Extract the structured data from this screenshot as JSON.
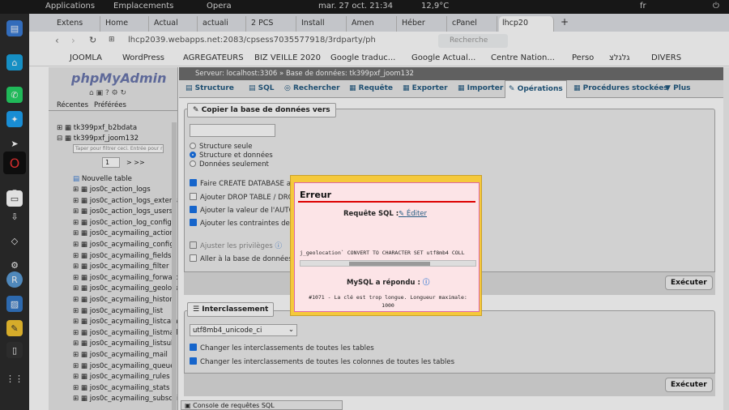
{
  "system": {
    "applications": "Applications",
    "places": "Emplacements",
    "browser": "Opera",
    "datetime": "mar. 27 oct. 21:34",
    "temp": "12,9°C",
    "lang": "fr"
  },
  "tabs": [
    "Extens",
    "Home",
    "Actual",
    "actuali",
    "2 PCS",
    "Install",
    "Amen",
    "Héber",
    "cPanel",
    "lhcp20"
  ],
  "url": "lhcp2039.webapps.net:2083/cpsess7035577918/3rdparty/ph",
  "search_placeholder": "Recherche",
  "bookmarks": [
    "JOOMLA",
    "WordPress",
    "AGREGATEURS",
    "BIZ VEILLE 2020",
    "Google traduc...",
    "Google Actual...",
    "Centre Nation...",
    "Perso",
    "גלגלצ",
    "DIVERS"
  ],
  "sidebar": {
    "logo": "phpMyAdmin",
    "tab_recent": "Récentes",
    "tab_prefs": "Préférées",
    "db1": "tk399pxf_b2bdata",
    "db2": "tk399pxf_joom132",
    "filter_placeholder": "Taper pour filtrer ceci. Entrée pour r",
    "page": "1",
    "next": "> >>",
    "new_table": "Nouvelle table",
    "tables": [
      "jos0c_action_logs",
      "jos0c_action_logs_extensi",
      "jos0c_action_logs_users",
      "jos0c_action_log_config",
      "jos0c_acymailing_action",
      "jos0c_acymailing_config",
      "jos0c_acymailing_fields",
      "jos0c_acymailing_filter",
      "jos0c_acymailing_forward",
      "jos0c_acymailing_geolocat",
      "jos0c_acymailing_history",
      "jos0c_acymailing_list",
      "jos0c_acymailing_listcamp",
      "jos0c_acymailing_listmail",
      "jos0c_acymailing_listsub",
      "jos0c_acymailing_mail",
      "jos0c_acymailing_queue",
      "jos0c_acymailing_rules",
      "jos0c_acymailing_stats",
      "jos0c_acymailing_subscrib"
    ]
  },
  "breadcrumb": {
    "server": "Serveur: localhost:3306",
    "db": "Base de données: tk399pxf_joom132"
  },
  "maintabs": [
    "Structure",
    "SQL",
    "Rechercher",
    "Requête",
    "Exporter",
    "Importer",
    "Opérations",
    "Procédures stockées",
    "Plus"
  ],
  "copy": {
    "legend": "Copier la base de données vers",
    "radio1": "Structure seule",
    "radio2": "Structure et données",
    "radio3": "Données seulement",
    "cb1": "Faire CREATE DATABASE a",
    "cb2": "Ajouter DROP TABLE / DRO",
    "cb3": "Ajouter la valeur de l'AUTO_",
    "cb4": "Ajouter les contraintes de clé",
    "cb5": "Ajuster les privilèges",
    "cb6": "Aller à la base de données co",
    "exec": "Exécuter"
  },
  "collation": {
    "legend": "Interclassement",
    "select": "utf8mb4_unicode_ci",
    "cb1": "Changer les interclassements de toutes les tables",
    "cb2": "Changer les interclassements de toutes les colonnes de toutes les tables",
    "exec": "Exécuter"
  },
  "console": "Console de requêtes SQL",
  "error": {
    "title": "Erreur",
    "sql_label": "Requête SQL :",
    "edit": "Éditer",
    "sql": "j_geolocation` CONVERT TO CHARACTER SET utf8mb4 COLL",
    "mysql_label": "MySQL a répondu :",
    "message": "#1071 - La clé est trop longue. Longueur maximale: 1000"
  }
}
